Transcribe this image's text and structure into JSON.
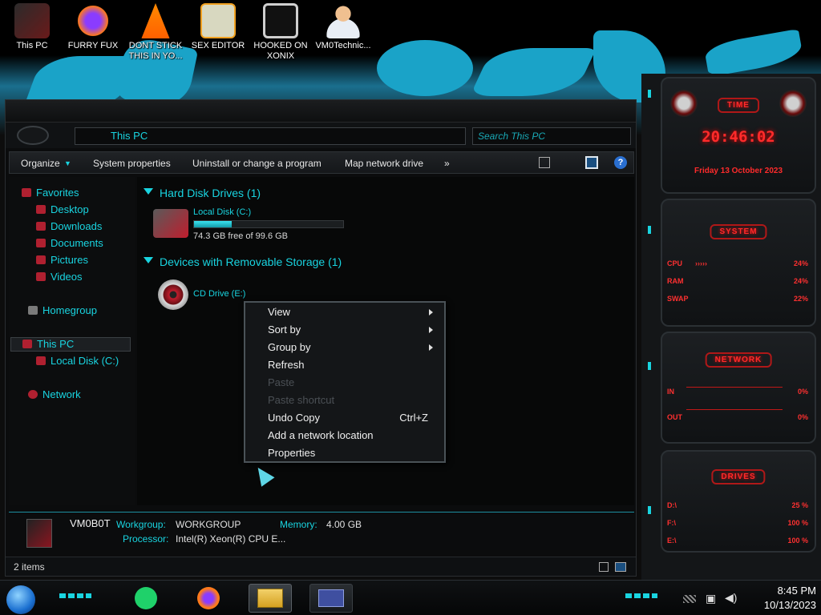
{
  "desktop": {
    "icons": [
      {
        "label": "This PC",
        "icon": "this-pc-icon"
      },
      {
        "label": "FURRY FUX",
        "icon": "firefox-icon"
      },
      {
        "label": "DONT STICK THIS IN YO...",
        "icon": "vlc-icon"
      },
      {
        "label": "SEX EDITOR",
        "icon": "hxd-icon"
      },
      {
        "label": "HOOKED ON XONIX",
        "icon": "game-icon"
      },
      {
        "label": "VM0Technic...",
        "icon": "user-icon"
      }
    ]
  },
  "explorer": {
    "address": "This PC",
    "search_placeholder": "Search This PC",
    "commands": {
      "organize": "Organize",
      "system_properties": "System properties",
      "uninstall": "Uninstall or change a program",
      "map_drive": "Map network drive",
      "more": "»"
    },
    "nav": {
      "favorites": "Favorites",
      "desktop": "Desktop",
      "downloads": "Downloads",
      "documents": "Documents",
      "pictures": "Pictures",
      "videos": "Videos",
      "homegroup": "Homegroup",
      "this_pc": "This PC",
      "local_disk": "Local Disk (C:)",
      "network": "Network"
    },
    "groups": {
      "hdd_title": "Hard Disk Drives (1)",
      "removable_title": "Devices with Removable Storage (1)"
    },
    "drives": {
      "c_name": "Local Disk (C:)",
      "c_free": "74.3 GB free of 99.6 GB",
      "c_used_fraction": 0.254,
      "e_name": "CD Drive (E:)"
    },
    "details": {
      "computer_name": "VM0B0T",
      "workgroup_label": "Workgroup:",
      "workgroup_value": "WORKGROUP",
      "memory_label": "Memory:",
      "memory_value": "4.00 GB",
      "processor_label": "Processor:",
      "processor_value": "Intel(R) Xeon(R) CPU E..."
    },
    "status": {
      "items": "2 items"
    }
  },
  "context_menu": {
    "view": "View",
    "sort_by": "Sort by",
    "group_by": "Group by",
    "refresh": "Refresh",
    "paste": "Paste",
    "paste_shortcut": "Paste shortcut",
    "undo_copy": "Undo Copy",
    "undo_shortcut": "Ctrl+Z",
    "add_network_location": "Add a network location",
    "properties": "Properties"
  },
  "gadgets": {
    "time_title": "TIME",
    "time_value": "20:46:02",
    "date_value": "Friday 13 October 2023",
    "system_title": "SYSTEM",
    "system_rows": [
      {
        "label": "CPU",
        "value": "24%"
      },
      {
        "label": "RAM",
        "value": "24%"
      },
      {
        "label": "SWAP",
        "value": "22%"
      }
    ],
    "network_title": "NETWORK",
    "network_rows": [
      {
        "label": "IN",
        "value": "0%"
      },
      {
        "label": "OUT",
        "value": "0%"
      }
    ],
    "drives_title": "DRIVES",
    "drive_rows": [
      {
        "label": "D:\\",
        "value": "25 %"
      },
      {
        "label": "F:\\",
        "value": "100 %"
      },
      {
        "label": "E:\\",
        "value": "100 %"
      }
    ],
    "accent": "#ff2b2b"
  },
  "taskbar": {
    "time": "8:45 PM",
    "date": "10/13/2023"
  }
}
